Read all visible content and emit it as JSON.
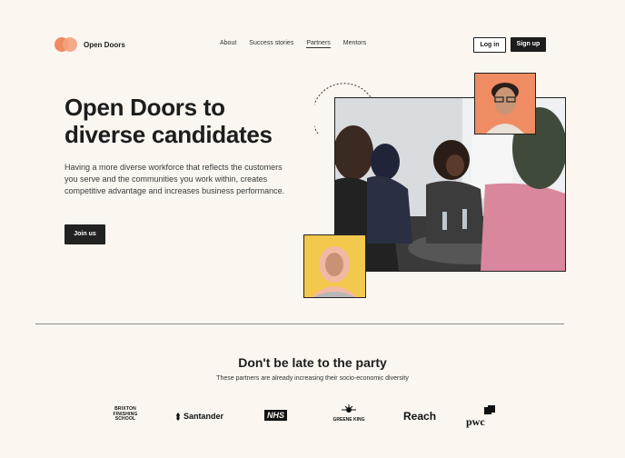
{
  "brand": {
    "name": "Open Doors"
  },
  "nav": {
    "links": [
      "About",
      "Success stories",
      "Partners",
      "Mentors"
    ],
    "login_label": "Log in",
    "signup_label": "Sign up"
  },
  "hero": {
    "title_line1": "Open Doors to",
    "title_line2": "diverse candidates",
    "description": "Having a more diverse workforce that reflects the customers you serve and the communities you work within, creates competitive advantage and increases business performance.",
    "cta_label": "Join us"
  },
  "partners": {
    "title": "Don't be late to the party",
    "subtitle": "These partners are already increasing their socio-economic diversity",
    "logos": [
      "BRIXTON FINISHING SCHOOL",
      "Santander",
      "NHS",
      "GREENE KING",
      "Reach",
      "pwc"
    ]
  },
  "colors": {
    "accent": "#f08a63",
    "background": "#fbf6ef",
    "dark": "#1d1d1d",
    "yellow": "#f2c94c"
  },
  "icons": [
    "logo-mark",
    "santander-flame-icon",
    "greene-king-emblem-icon",
    "pwc-mark-icon"
  ]
}
